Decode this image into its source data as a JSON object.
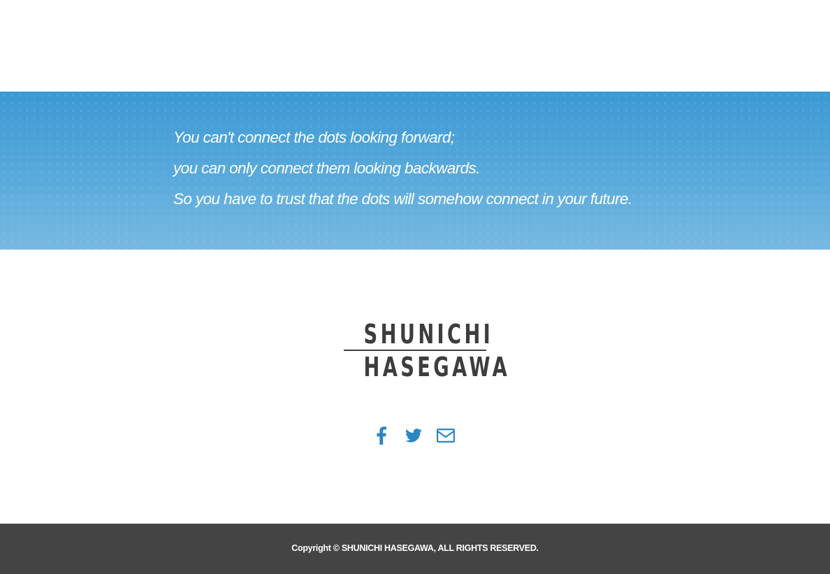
{
  "quote": {
    "lines": [
      "You can't connect the dots looking forward;",
      "you can only connect them looking backwards.",
      "So you have to trust that the dots will somehow connect in your future."
    ]
  },
  "logo": {
    "line1": "SHUNICHI",
    "line2": "HASEGAWA"
  },
  "social": {
    "icons": [
      "facebook-icon",
      "twitter-icon",
      "mail-icon"
    ],
    "color": "#2b86c5"
  },
  "footer": {
    "copyright": "Copyright © SHUNICHI HASEGAWA, ALL RIGHTS RESERVED.",
    "background": "#444444"
  },
  "colors": {
    "band_top": "#3c99d3",
    "band_bottom": "#77b9e2",
    "logo_text": "#3d3d3d"
  }
}
